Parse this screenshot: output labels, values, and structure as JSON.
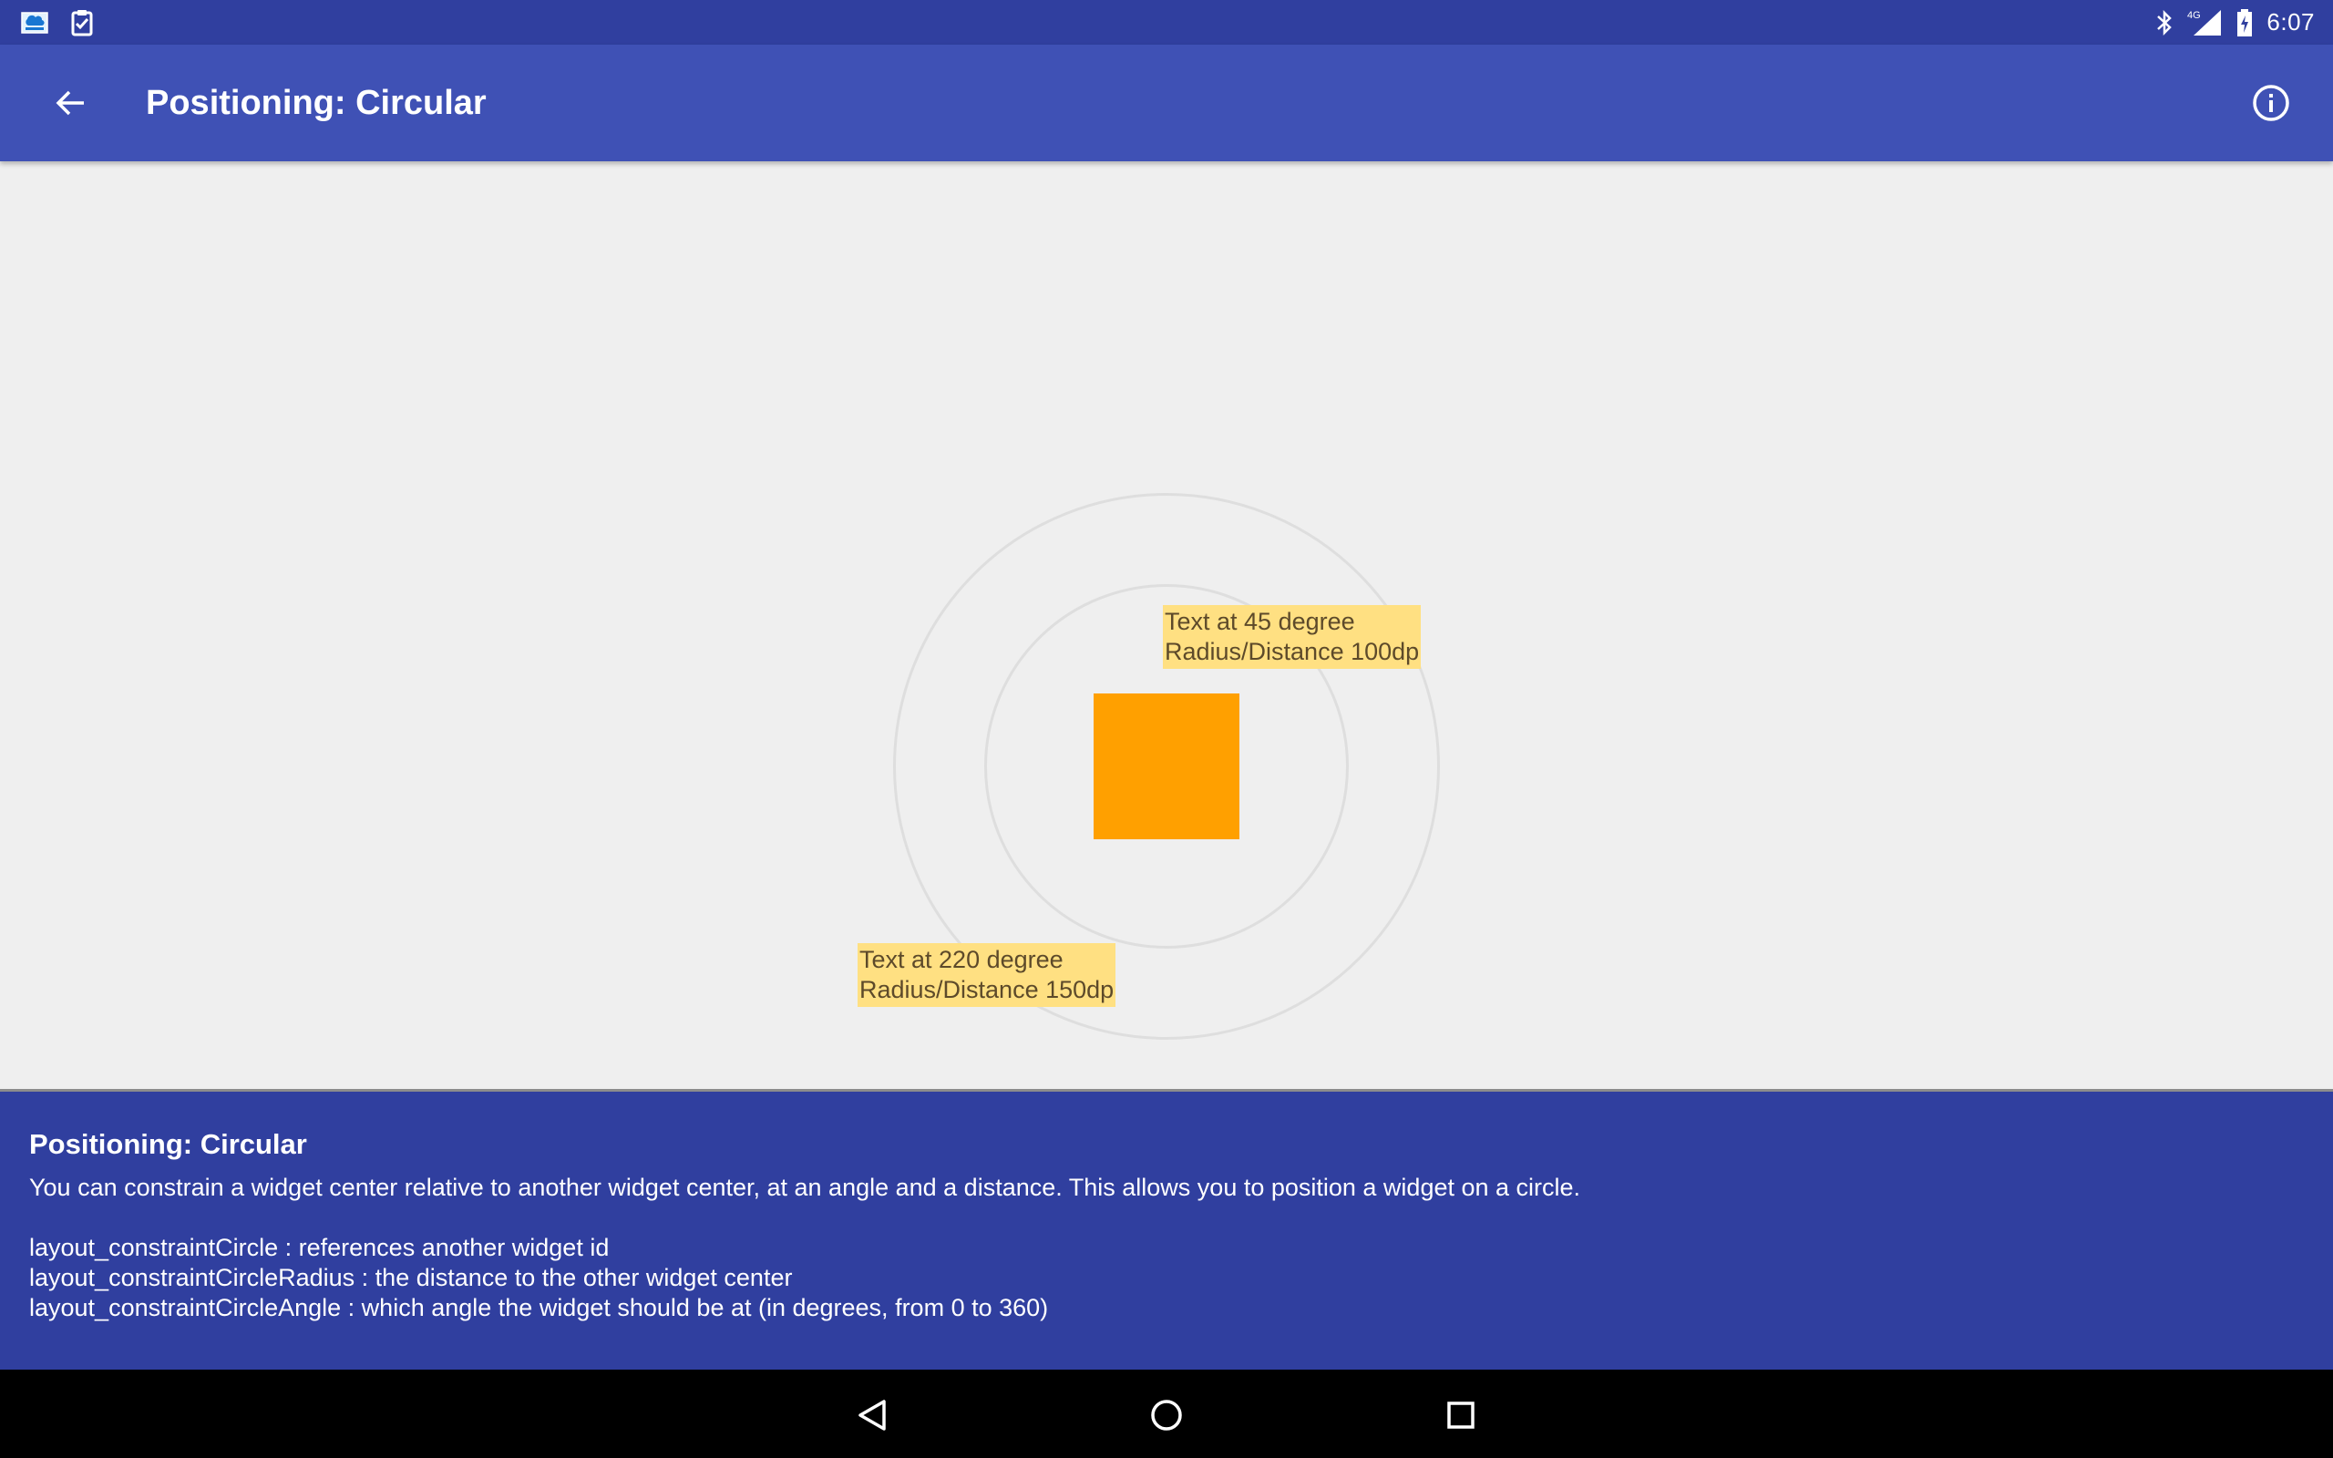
{
  "status_bar": {
    "notification_icons": [
      "app-store-icon",
      "clipboard-check-icon"
    ],
    "system_icons": [
      "bluetooth-icon",
      "signal-4g-icon",
      "battery-charging-icon"
    ],
    "network_label": "4G",
    "time": "6:07"
  },
  "toolbar": {
    "title": "Positioning: Circular",
    "back_icon": "arrow-left-icon",
    "info_icon": "info-icon",
    "color": "#3f51b5"
  },
  "demo": {
    "center_color": "#ffa000",
    "label_color": "#ffe082",
    "label_45": {
      "line1": "Text at 45 degree",
      "line2": "Radius/Distance 100dp"
    },
    "label_220": {
      "line1": "Text at 220 degree",
      "line2": "Radius/Distance 150dp"
    }
  },
  "description": {
    "title": "Positioning: Circular",
    "text": "You can constrain a widget center relative to another widget center, at an angle and a distance. This allows you to position a widget on a circle.",
    "lines": [
      "layout_constraintCircle : references another widget id",
      "layout_constraintCircleRadius : the distance to the other widget center",
      "layout_constraintCircleAngle : which angle the widget should be at (in degrees, from 0 to 360)"
    ],
    "color": "#303f9f"
  },
  "nav_bar": {
    "buttons": [
      "back-triangle-icon",
      "home-circle-icon",
      "recents-square-icon"
    ]
  }
}
